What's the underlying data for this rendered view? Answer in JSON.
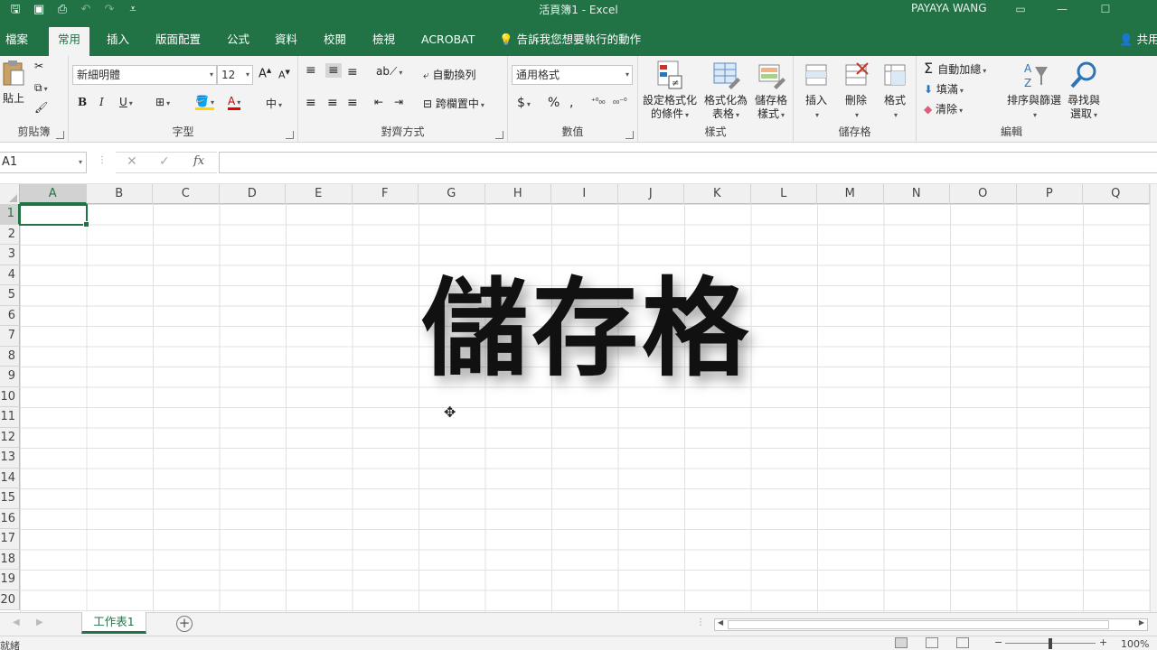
{
  "titlebar": {
    "title": "活頁簿1  -  Excel",
    "user": "PAYAYA WANG",
    "brand_color": "#217346"
  },
  "tabs": {
    "items": [
      "檔案",
      "常用",
      "插入",
      "版面配置",
      "公式",
      "資料",
      "校閱",
      "檢視",
      "ACROBAT"
    ],
    "active": "常用",
    "tell_me": "告訴我您想要執行的動作",
    "share": "共用"
  },
  "ribbon": {
    "clipboard": {
      "paste": "貼上",
      "label": "剪貼簿"
    },
    "font": {
      "name": "新細明體",
      "size": "12",
      "bold": "B",
      "italic": "I",
      "underline": "U",
      "label": "字型"
    },
    "alignment": {
      "wrap": "自動換列",
      "merge": "跨欄置中",
      "label": "對齊方式"
    },
    "number": {
      "format": "通用格式",
      "label": "數值"
    },
    "styles": {
      "conditional_l1": "設定格式化",
      "conditional_l2": "的條件",
      "table_l1": "格式化為",
      "table_l2": "表格",
      "cell_l1": "儲存格",
      "cell_l2": "樣式",
      "label": "樣式"
    },
    "cells": {
      "insert": "插入",
      "delete": "刪除",
      "format": "格式",
      "label": "儲存格"
    },
    "editing": {
      "autosum": "自動加總",
      "fill": "填滿",
      "clear": "清除",
      "sort_l1": "排序與篩選",
      "find_l1": "尋找與",
      "find_l2": "選取",
      "label": "編輯"
    }
  },
  "formula_bar": {
    "name_box": "A1",
    "fx": "fx",
    "value": ""
  },
  "grid": {
    "columns": [
      "A",
      "B",
      "C",
      "D",
      "E",
      "F",
      "G",
      "H",
      "I",
      "J",
      "K",
      "L",
      "M",
      "N",
      "O",
      "P",
      "Q"
    ],
    "rows": [
      "1",
      "2",
      "3",
      "4",
      "5",
      "6",
      "7",
      "8",
      "9",
      "10",
      "11",
      "12",
      "13",
      "14",
      "15",
      "16",
      "17",
      "18",
      "19",
      "20"
    ],
    "active_cell": "A1"
  },
  "overlay_text": "儲存格",
  "sheets": {
    "tabs": [
      "工作表1"
    ]
  },
  "status": {
    "ready": "就緒",
    "zoom": "100%"
  }
}
